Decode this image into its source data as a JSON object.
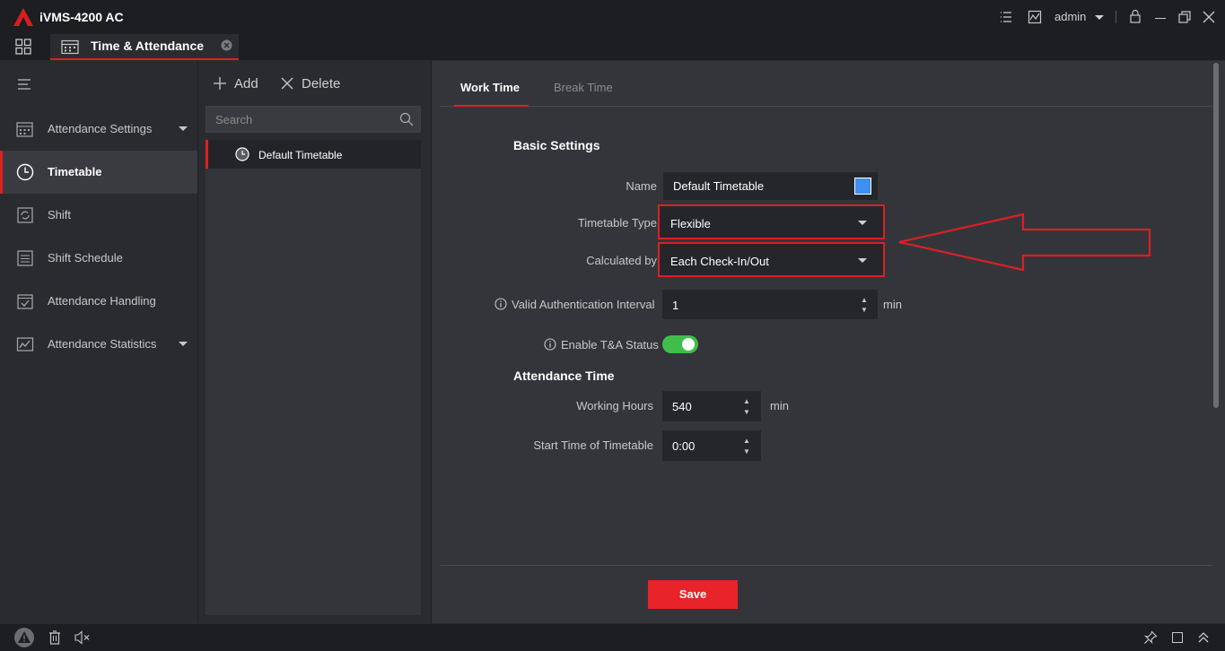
{
  "app": {
    "title": "iVMS-4200 AC",
    "user": "admin"
  },
  "tab": {
    "label": "Time & Attendance"
  },
  "nav": {
    "items": [
      {
        "label": "Attendance Settings",
        "has_caret": true
      },
      {
        "label": "Timetable",
        "active": true
      },
      {
        "label": "Shift"
      },
      {
        "label": "Shift Schedule"
      },
      {
        "label": "Attendance Handling"
      },
      {
        "label": "Attendance Statistics",
        "has_caret": true
      }
    ]
  },
  "list": {
    "add_label": "Add",
    "delete_label": "Delete",
    "search_placeholder": "Search",
    "items": [
      {
        "label": "Default Timetable"
      }
    ]
  },
  "content": {
    "tabs": [
      {
        "label": "Work Time",
        "active": true
      },
      {
        "label": "Break Time"
      }
    ],
    "basic_title": "Basic Settings",
    "name_label": "Name",
    "name_value": "Default Timetable",
    "name_color": "#3d8ff0",
    "type_label": "Timetable Type",
    "type_value": "Flexible",
    "calc_label": "Calculated by",
    "calc_value": "Each Check-In/Out",
    "interval_label": "Valid Authentication Interval",
    "interval_value": "1",
    "interval_unit": "min",
    "status_label": "Enable T&A Status",
    "status_on": true,
    "attendance_title": "Attendance Time",
    "hours_label": "Working Hours",
    "hours_value": "540",
    "hours_unit": "min",
    "start_label": "Start Time of Timetable",
    "start_value": "0:00",
    "save_label": "Save"
  },
  "colors": {
    "accent": "#e02020",
    "toggle_on": "#3fbf4a",
    "save": "#e8232a"
  }
}
